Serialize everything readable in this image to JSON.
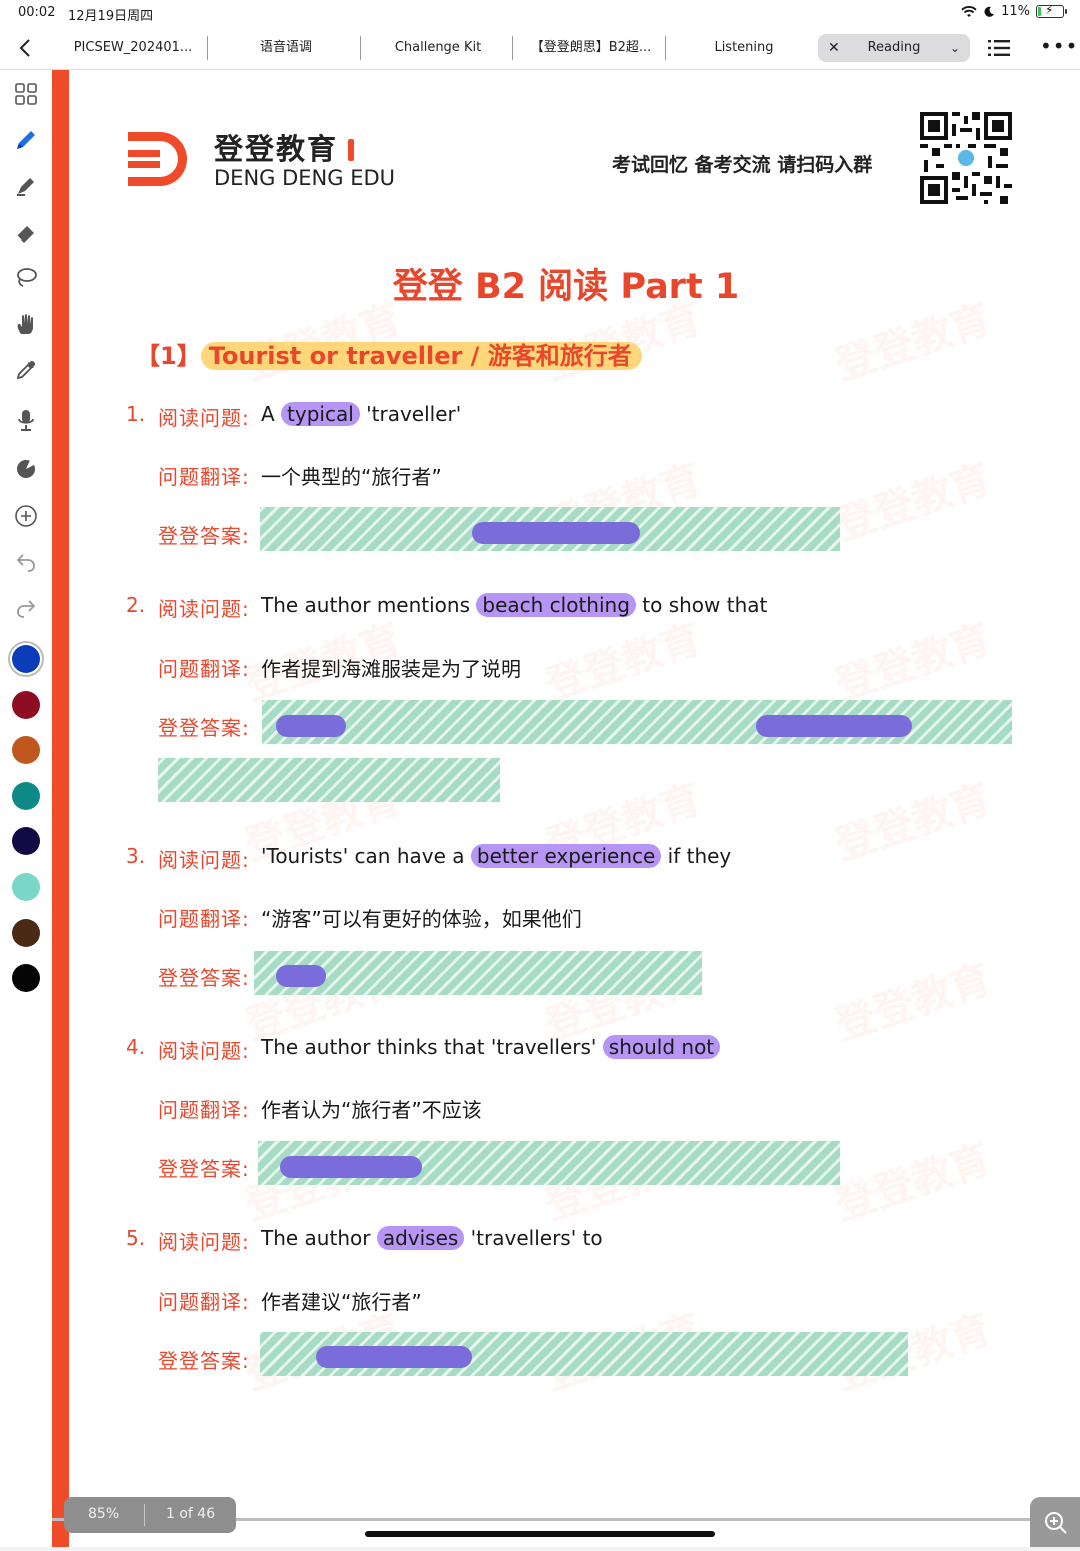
{
  "status": {
    "time": "00:02",
    "date": "12月19日周四",
    "battery": "11%",
    "battery_level": 0.11
  },
  "tabs": [
    {
      "label": "PICSEW_202401..."
    },
    {
      "label": "语音语调"
    },
    {
      "label": "Challenge Kit"
    },
    {
      "label": "【登登朗思】B2超..."
    },
    {
      "label": "Listening"
    },
    {
      "label": "Reading",
      "active": true
    }
  ],
  "toolbar": {
    "tools": [
      "grid-icon",
      "pen-icon",
      "highlighter-icon",
      "eraser-icon",
      "lasso-icon",
      "hand-icon",
      "eyedropper-icon",
      "microphone-icon",
      "shape-icon",
      "add-icon",
      "undo-icon",
      "redo-icon"
    ],
    "colors": [
      "#0b3db8",
      "#8e0d22",
      "#c0581d",
      "#0f8a86",
      "#120a45",
      "#79d6c9",
      "#4a2a17",
      "#050505"
    ],
    "selected_color": 0
  },
  "header": {
    "brand_cn": "登登教育",
    "brand_en": "DENG DENG EDU",
    "slogan": "考试回忆 备考交流 请扫码入群",
    "brand_color": "#ef4a2a"
  },
  "doc": {
    "title": "登登 B2 阅读  Part 1",
    "section_index": "【1】",
    "section_title": "Tourist or traveller /  游客和旅行者",
    "label_question": "阅读问题:",
    "label_translation": "问题翻译:",
    "label_answer": "登登答案:",
    "questions": [
      {
        "num": "1.",
        "q_pre": "A ",
        "q_hl": "typical",
        "q_post": " 'traveller'",
        "translation": "一个典型的“旅行者”"
      },
      {
        "num": "2.",
        "q_pre": "The author mentions ",
        "q_hl": "beach clothing",
        "q_post": " to show that",
        "translation": "作者提到海滩服装是为了说明"
      },
      {
        "num": "3.",
        "q_pre": "'Tourists' can have a ",
        "q_hl": "better experience",
        "q_post": " if they",
        "translation": "“游客”可以有更好的体验，如果他们"
      },
      {
        "num": "4.",
        "q_pre": "The author thinks that  'travellers' ",
        "q_hl": "should not",
        "q_post": "",
        "translation": "作者认为“旅行者”不应该"
      },
      {
        "num": "5.",
        "q_pre": "The author ",
        "q_hl": "advises",
        "q_post": " 'travellers' to",
        "translation": "作者建议“旅行者”"
      }
    ]
  },
  "viewer": {
    "zoom": "85%",
    "pages": "1 of 46"
  }
}
